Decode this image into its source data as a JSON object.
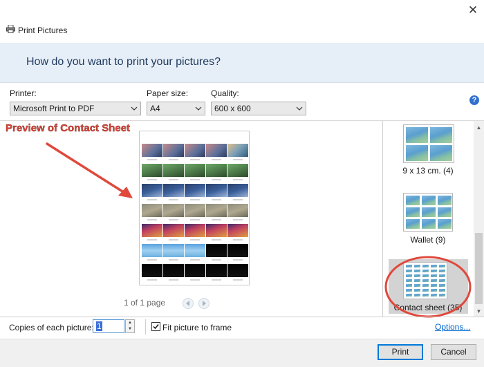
{
  "window": {
    "title": "Print Pictures",
    "close_glyph": "✕",
    "icon": "printer-icon"
  },
  "header": {
    "question": "How do you want to print your pictures?"
  },
  "printer": {
    "label": "Printer:",
    "value": "Microsoft Print to PDF"
  },
  "paper": {
    "label": "Paper size:",
    "value": "A4"
  },
  "quality": {
    "label": "Quality:",
    "value": "600 x 600"
  },
  "help": {
    "glyph": "?"
  },
  "annotation": {
    "text": "Preview of Contact Sheet",
    "color": "#e0483c"
  },
  "preview": {
    "page_info": "1 of 1 page",
    "prev_icon": "left-arrow-icon",
    "next_icon": "right-arrow-icon",
    "thumbnail_count": 35
  },
  "layouts": {
    "items": [
      {
        "label": "9 x 13 cm. (4)",
        "selected": false
      },
      {
        "label": "Wallet (9)",
        "selected": false
      },
      {
        "label": "Contact sheet (35)",
        "selected": true
      }
    ]
  },
  "copies": {
    "label": "Copies of each picture:",
    "value": "1"
  },
  "fit": {
    "label": "Fit picture to frame",
    "checked": true
  },
  "options_link": "Options...",
  "buttons": {
    "print": "Print",
    "cancel": "Cancel"
  }
}
